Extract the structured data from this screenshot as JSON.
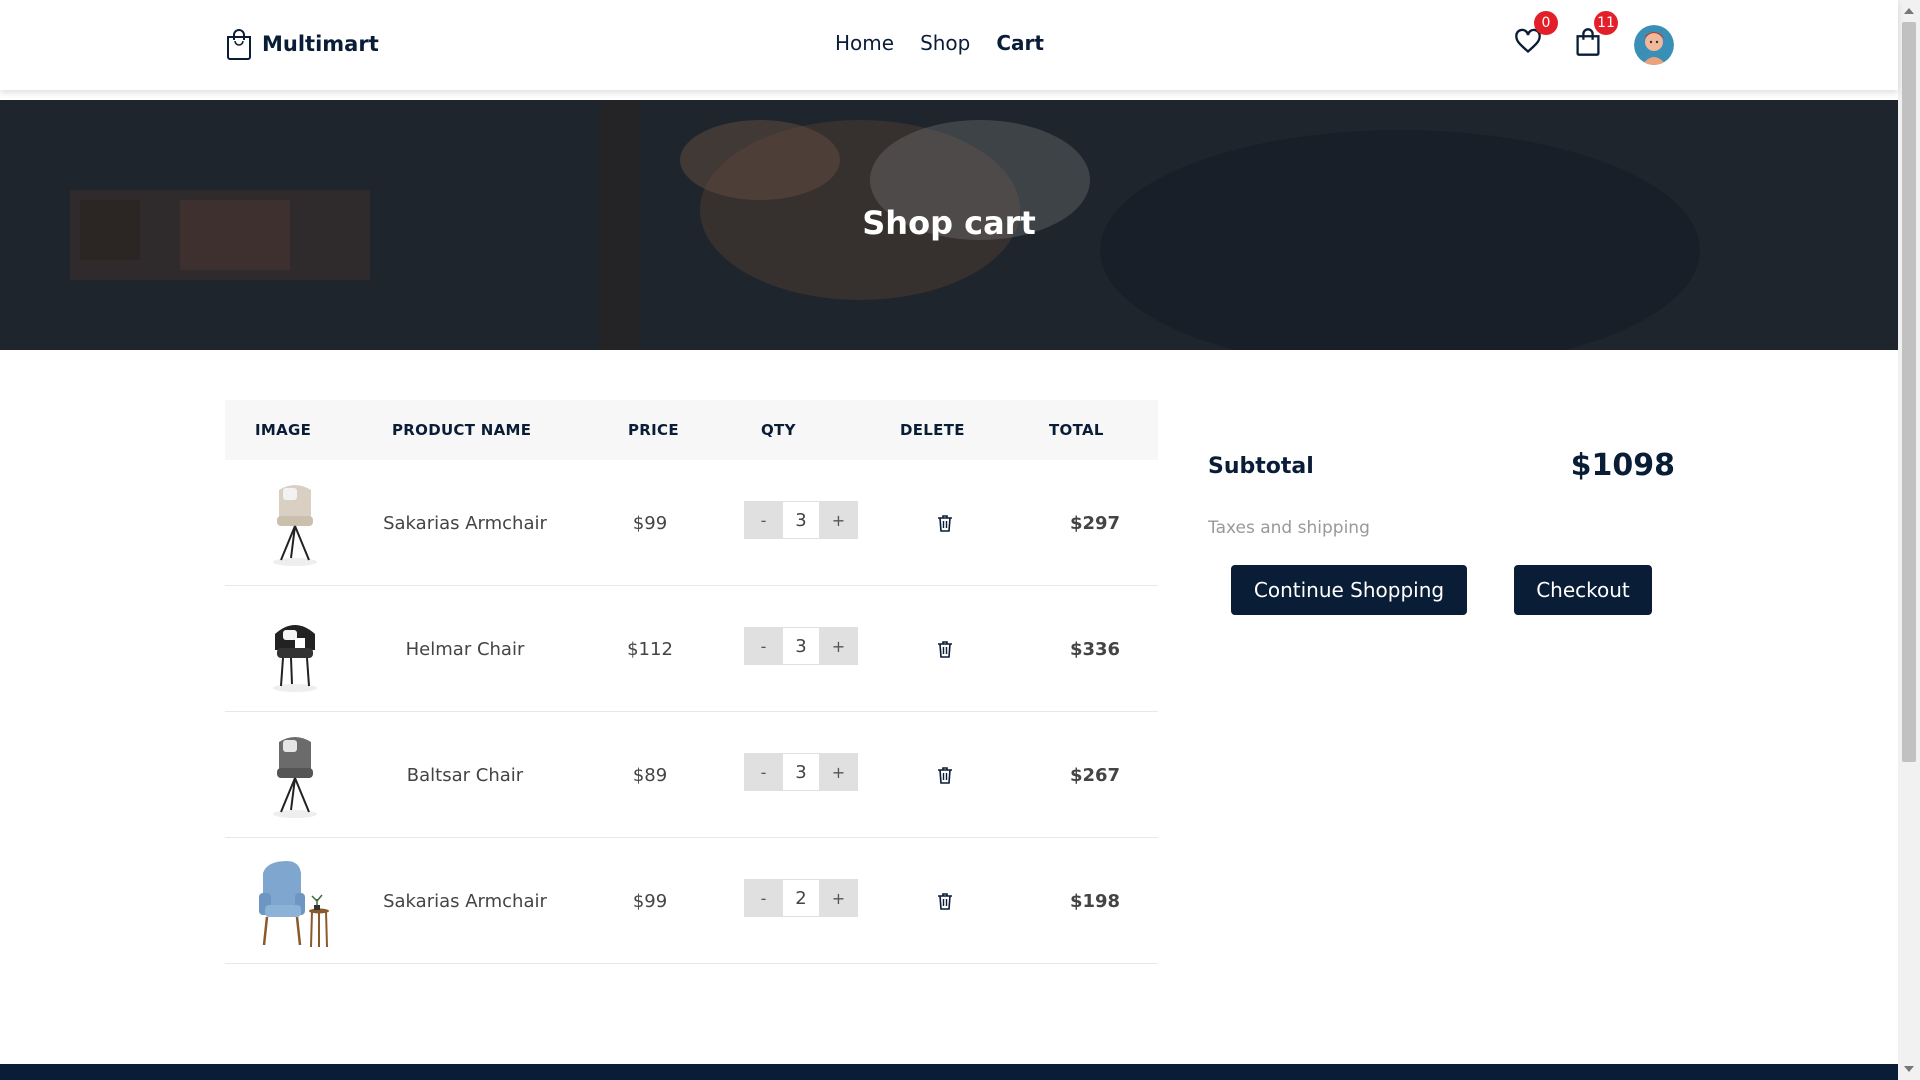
{
  "brand": {
    "name": "Multimart"
  },
  "nav": {
    "items": [
      {
        "label": "Home"
      },
      {
        "label": "Shop"
      },
      {
        "label": "Cart"
      }
    ],
    "active": "Cart"
  },
  "header_icons": {
    "wishlist": {
      "icon": "heart-icon",
      "count": "0"
    },
    "cart": {
      "icon": "shopping-bag-icon",
      "count": "11"
    },
    "profile": {
      "icon": "user-avatar"
    }
  },
  "hero": {
    "title": "Shop cart"
  },
  "table": {
    "headers": [
      "IMAGE",
      "PRODUCT NAME",
      "PRICE",
      "QTY",
      "DELETE",
      "TOTAL"
    ],
    "rows": [
      {
        "image": "chair-beige-icon",
        "name": "Sakarias Armchair",
        "price": "$99",
        "qty": "3",
        "total": "$297"
      },
      {
        "image": "chair-black-white-icon",
        "name": "Helmar Chair",
        "price": "$112",
        "qty": "3",
        "total": "$336"
      },
      {
        "image": "chair-grey-icon",
        "name": "Baltsar Chair",
        "price": "$89",
        "qty": "3",
        "total": "$267"
      },
      {
        "image": "armchair-blue-icon",
        "name": "Sakarias Armchair",
        "price": "$99",
        "qty": "2",
        "total": "$198"
      }
    ],
    "qty_minus": "-",
    "qty_plus": "+"
  },
  "summary": {
    "subtotal_label": "Subtotal",
    "subtotal_value": "$1098",
    "taxes_note": "Taxes and shipping",
    "continue_label": "Continue Shopping",
    "checkout_label": "Checkout"
  },
  "colors": {
    "primary": "#0a1d37",
    "badge": "#e3202a"
  }
}
